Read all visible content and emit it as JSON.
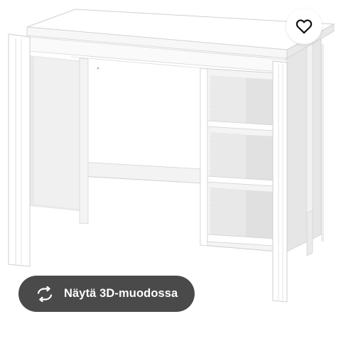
{
  "product_image": {
    "subject": "white desk with open shelf unit",
    "background_color": "#ffffff"
  },
  "favourite": {
    "icon": "heart-icon"
  },
  "view_3d": {
    "label": "Näytä 3D-muodossa",
    "icon": "rotate-arrows-icon",
    "background_color": "#4a4a4a",
    "text_color": "#ffffff"
  }
}
